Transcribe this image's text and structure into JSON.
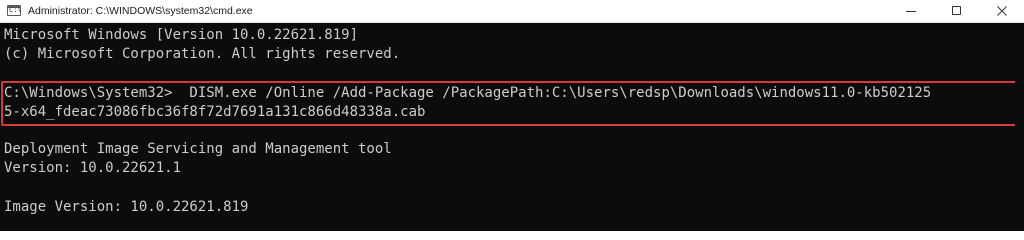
{
  "window": {
    "title": "Administrator: C:\\WINDOWS\\system32\\cmd.exe",
    "icon": "cmd-icon",
    "icon_glyph": "C:\\",
    "controls": {
      "minimize": "minimize-icon",
      "maximize": "maximize-icon",
      "close": "close-icon"
    }
  },
  "console": {
    "lines": [
      "Microsoft Windows [Version 10.0.22621.819]",
      "(c) Microsoft Corporation. All rights reserved.",
      "",
      "C:\\Windows\\System32>  DISM.exe /Online /Add-Package /PackagePath:C:\\Users\\redsp\\Downloads\\windows11.0-kb502125",
      "5-x64_fdeac73086fbc36f8f72d7691a131c866d48338a.cab",
      "",
      "Deployment Image Servicing and Management tool",
      "Version: 10.0.22621.1",
      "",
      "Image Version: 10.0.22621.819"
    ],
    "background": "#0c0c0c",
    "text_color": "#cccccc",
    "highlight_color": "#d63a3a"
  }
}
